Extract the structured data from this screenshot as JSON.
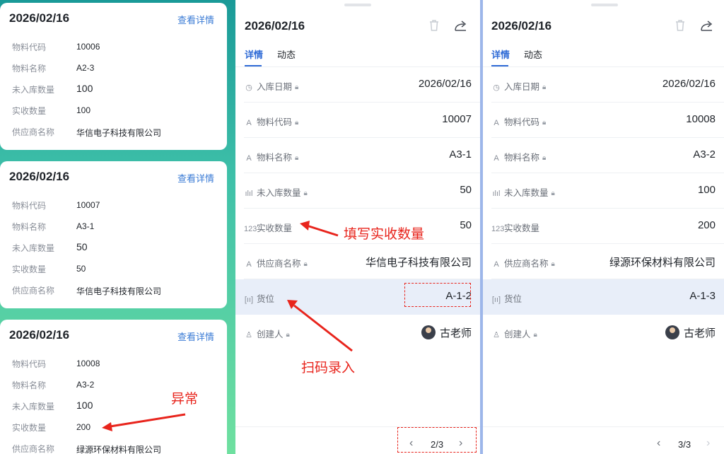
{
  "list": {
    "cards": [
      {
        "date": "2026/02/16",
        "link": "查看详情",
        "rows": [
          {
            "label": "物料代码",
            "value": "10006"
          },
          {
            "label": "物料名称",
            "value": "A2-3"
          },
          {
            "label": "未入库数量",
            "value": "100"
          },
          {
            "label": "实收数量",
            "value": "100"
          },
          {
            "label": "供应商名称",
            "value": "华信电子科技有限公司"
          }
        ]
      },
      {
        "date": "2026/02/16",
        "link": "查看详情",
        "rows": [
          {
            "label": "物料代码",
            "value": "10007"
          },
          {
            "label": "物料名称",
            "value": "A3-1"
          },
          {
            "label": "未入库数量",
            "value": "50"
          },
          {
            "label": "实收数量",
            "value": "50"
          },
          {
            "label": "供应商名称",
            "value": "华信电子科技有限公司"
          }
        ]
      },
      {
        "date": "2026/02/16",
        "link": "查看详情",
        "rows": [
          {
            "label": "物料代码",
            "value": "10008"
          },
          {
            "label": "物料名称",
            "value": "A3-2"
          },
          {
            "label": "未入库数量",
            "value": "100"
          },
          {
            "label": "实收数量",
            "value": "200"
          },
          {
            "label": "供应商名称",
            "value": "绿源环保材料有限公司"
          }
        ]
      }
    ]
  },
  "panels": [
    {
      "date": "2026/02/16",
      "tabs": [
        "详情",
        "动态"
      ],
      "fields": [
        {
          "icon": "clock-icon",
          "glyph": "◷",
          "label": "入库日期",
          "locked": true,
          "value": "2026/02/16"
        },
        {
          "icon": "text-icon",
          "glyph": "A",
          "label": "物料代码",
          "locked": true,
          "value": "10007"
        },
        {
          "icon": "text-icon",
          "glyph": "A",
          "label": "物料名称",
          "locked": true,
          "value": "A3-1"
        },
        {
          "icon": "bar-chart-icon",
          "glyph": "ılıl",
          "label": "未入库数量",
          "locked": true,
          "value": "50"
        },
        {
          "icon": "number-icon",
          "glyph": "123",
          "label": "实收数量",
          "locked": false,
          "value": "50"
        },
        {
          "icon": "text-icon",
          "glyph": "A",
          "label": "供应商名称",
          "locked": true,
          "value": "华信电子科技有限公司"
        },
        {
          "icon": "scan-icon",
          "glyph": "[ıı]",
          "label": "货位",
          "locked": false,
          "value": "A-1-2"
        },
        {
          "icon": "user-icon",
          "glyph": "♙",
          "label": "创建人",
          "locked": true,
          "value": "古老师"
        }
      ],
      "pager": "2/3"
    },
    {
      "date": "2026/02/16",
      "tabs": [
        "详情",
        "动态"
      ],
      "fields": [
        {
          "icon": "clock-icon",
          "glyph": "◷",
          "label": "入库日期",
          "locked": true,
          "value": "2026/02/16"
        },
        {
          "icon": "text-icon",
          "glyph": "A",
          "label": "物料代码",
          "locked": true,
          "value": "10008"
        },
        {
          "icon": "text-icon",
          "glyph": "A",
          "label": "物料名称",
          "locked": true,
          "value": "A3-2"
        },
        {
          "icon": "bar-chart-icon",
          "glyph": "ılıl",
          "label": "未入库数量",
          "locked": true,
          "value": "100"
        },
        {
          "icon": "number-icon",
          "glyph": "123",
          "label": "实收数量",
          "locked": false,
          "value": "200"
        },
        {
          "icon": "text-icon",
          "glyph": "A",
          "label": "供应商名称",
          "locked": true,
          "value": "绿源环保材料有限公司"
        },
        {
          "icon": "scan-icon",
          "glyph": "[ıı]",
          "label": "货位",
          "locked": false,
          "value": "A-1-3"
        },
        {
          "icon": "user-icon",
          "glyph": "♙",
          "label": "创建人",
          "locked": true,
          "value": "古老师"
        }
      ],
      "pager": "3/3"
    }
  ],
  "annotations": {
    "fill_actual_qty": "填写实收数量",
    "scan_input": "扫码录入",
    "abnormal": "异常"
  },
  "colors": {
    "accent": "#2f6bd6",
    "annotation": "#e8241c",
    "highlight_row": "#e8eef9"
  }
}
